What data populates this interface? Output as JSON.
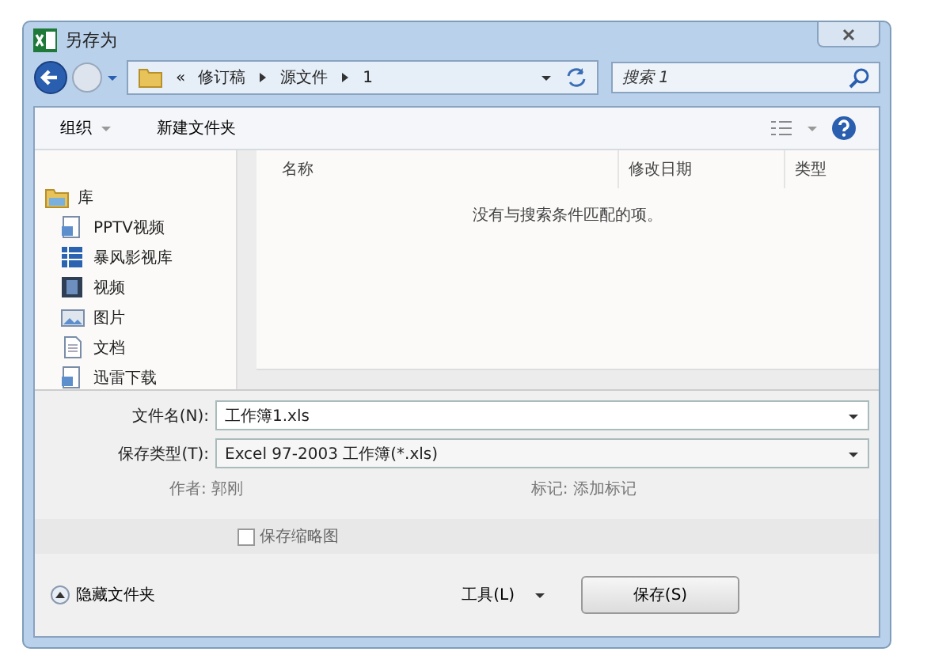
{
  "window": {
    "title": "另存为"
  },
  "address": {
    "overflow": "«",
    "crumbs": [
      "修订稿",
      "源文件",
      "1"
    ]
  },
  "search": {
    "placeholder": "搜索 1"
  },
  "toolbar": {
    "organize": "组织",
    "new_folder": "新建文件夹"
  },
  "sidebar": {
    "section": "库",
    "items": [
      {
        "label": "PPTV视频",
        "kind": "player"
      },
      {
        "label": "暴风影视库",
        "kind": "grid"
      },
      {
        "label": "视频",
        "kind": "film"
      },
      {
        "label": "图片",
        "kind": "image"
      },
      {
        "label": "文档",
        "kind": "doc"
      },
      {
        "label": "迅雷下载",
        "kind": "player"
      }
    ]
  },
  "table": {
    "columns": [
      "名称",
      "修改日期",
      "类型"
    ],
    "empty_message": "没有与搜索条件匹配的项。"
  },
  "fields": [
    {
      "label": "文件名(N):",
      "value": "工作簿1.xls"
    },
    {
      "label": "保存类型(T):",
      "value": "Excel 97-2003 工作簿(*.xls)"
    }
  ],
  "meta": [
    {
      "label": "作者:",
      "value": "郭刚"
    },
    {
      "label": "标记:",
      "value": "添加标记"
    }
  ],
  "save_thumbnail": {
    "label": "保存缩略图",
    "checked": false
  },
  "footer": {
    "hide_folders": "隐藏文件夹",
    "tools": "工具(L)",
    "save": "保存(S)"
  }
}
